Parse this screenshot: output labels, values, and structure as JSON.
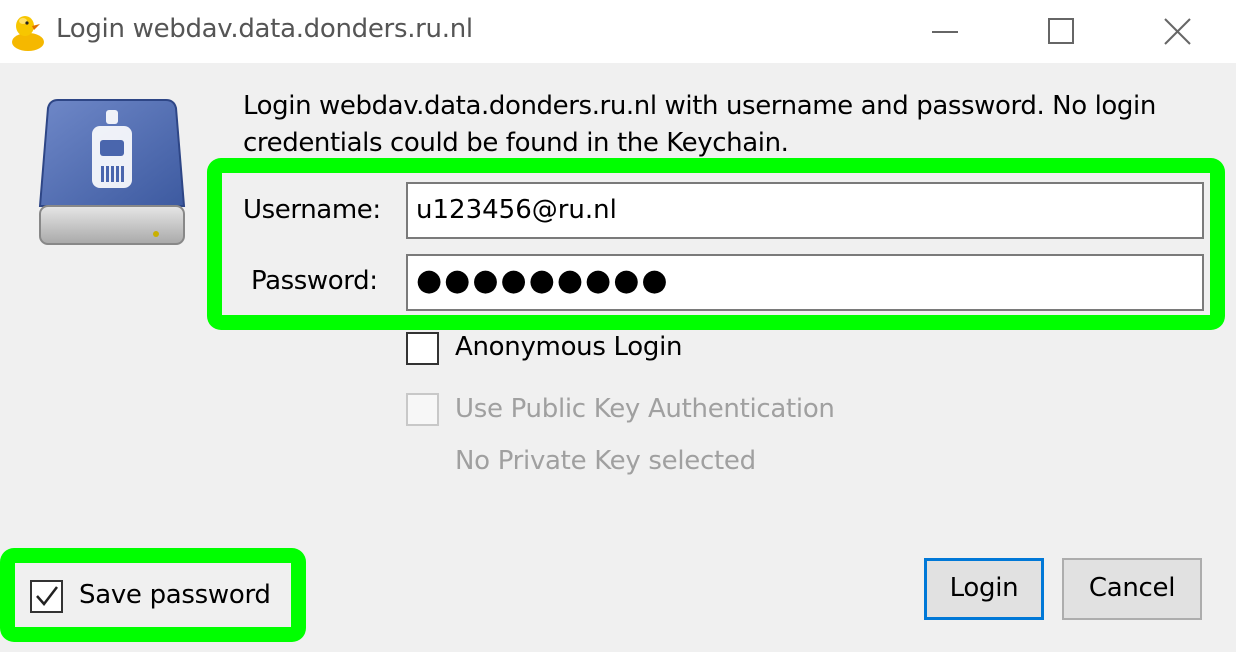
{
  "window": {
    "title": "Login webdav.data.donders.ru.nl",
    "app_icon": "duck-icon",
    "controls": [
      "minimize-icon",
      "maximize-icon",
      "close-icon"
    ]
  },
  "dialog": {
    "icon": "network-drive-icon",
    "message": "Login webdav.data.donders.ru.nl with username and password. No login credentials could be found in the Keychain.",
    "username_label": "Username:",
    "username_value": "u123456@ru.nl",
    "password_label": "Password:",
    "password_value": "●●●●●●●●●",
    "anonymous_label": "Anonymous Login",
    "anonymous_checked": false,
    "public_key_label": "Use Public Key Authentication",
    "public_key_checked": false,
    "public_key_disabled": true,
    "no_key_text": "No Private Key selected",
    "save_password_label": "Save password",
    "save_password_checked": true,
    "login_button": "Login",
    "cancel_button": "Cancel"
  },
  "colors": {
    "highlight": "#00ff00",
    "focus_border": "#0078d7"
  }
}
